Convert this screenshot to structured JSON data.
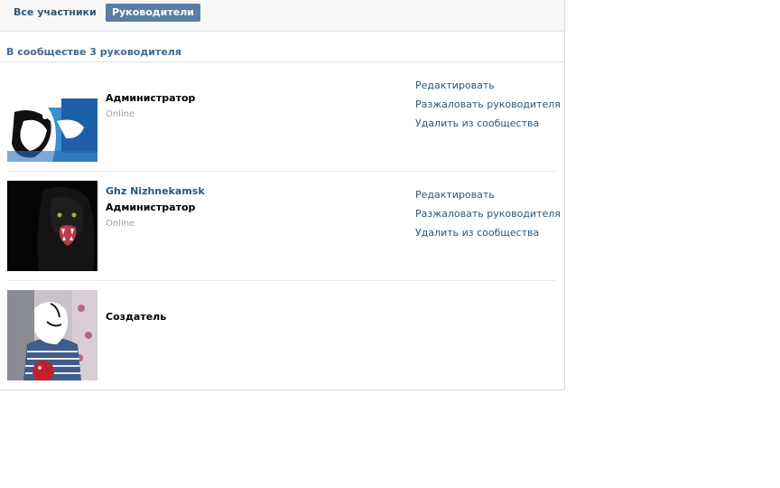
{
  "tabs": [
    {
      "label": "Все участники",
      "active": false
    },
    {
      "label": "Руководители",
      "active": true
    }
  ],
  "summary_text": "В сообществе 3 руководителя",
  "managers": [
    {
      "name": "",
      "role": "Администратор",
      "status": "Online",
      "actions": [
        "Редактировать",
        "Разжаловать руководителя",
        "Удалить из сообщества"
      ]
    },
    {
      "name": "Ghz Nizhnekamsk",
      "role": "Администратор",
      "status": "Online",
      "actions": [
        "Редактировать",
        "Разжаловать руководителя",
        "Удалить из сообщества"
      ]
    },
    {
      "name": "",
      "role": "Создатель",
      "status": "",
      "actions": []
    }
  ],
  "colors": {
    "link": "#2b587a",
    "active_tab_bg": "#597da3",
    "header": "#45688e",
    "muted": "#a0a0a0"
  }
}
